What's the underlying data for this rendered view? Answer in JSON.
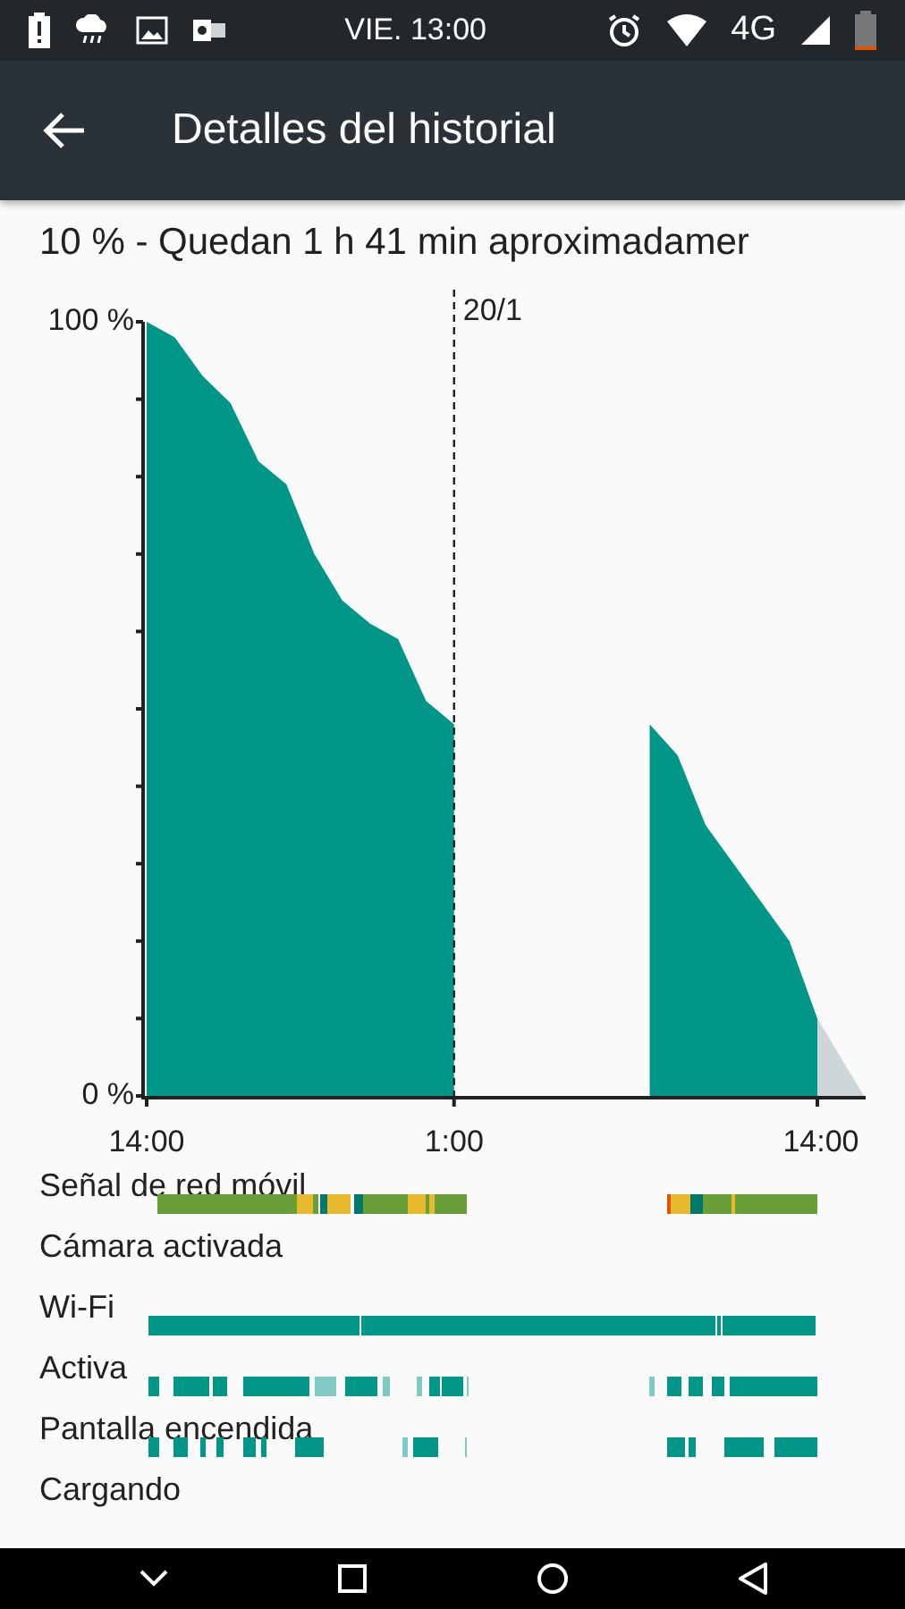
{
  "status_bar": {
    "time": "VIE. 13:00",
    "network": "4G"
  },
  "app_bar": {
    "title": "Detalles del historial"
  },
  "summary": "10 % - Quedan 1 h 41 min aproximadamer",
  "battery_chart": {
    "chart_data": {
      "type": "area",
      "categories": [
        "14:00",
        null,
        null,
        null,
        null,
        null,
        null,
        null,
        null,
        null,
        null,
        "1:00",
        null,
        null,
        null,
        null,
        null,
        null,
        null,
        null,
        null,
        null,
        null,
        null,
        "14:00"
      ],
      "values": [
        100,
        98,
        93,
        89.5,
        82,
        79,
        70,
        64,
        61,
        59,
        51,
        48,
        null,
        null,
        null,
        null,
        null,
        null,
        48,
        44,
        35,
        30,
        25,
        20,
        10
      ],
      "color": "#009688",
      "ylim": [
        0,
        100
      ],
      "yticks": [
        {
          "value": 0,
          "label": "0 %"
        },
        {
          "value": 100,
          "label": "100 %"
        }
      ],
      "annotations": [
        "20/1"
      ]
    }
  },
  "activity_rows": [
    {
      "label": "Señal de red móvil",
      "kind": "signal"
    },
    {
      "label": "Cámara activada",
      "kind": "none"
    },
    {
      "label": "Wi-Fi",
      "kind": "wifi"
    },
    {
      "label": "Activa",
      "kind": "active"
    },
    {
      "label": "Pantalla encendida",
      "kind": "screen"
    },
    {
      "label": "Cargando",
      "kind": "none"
    }
  ]
}
